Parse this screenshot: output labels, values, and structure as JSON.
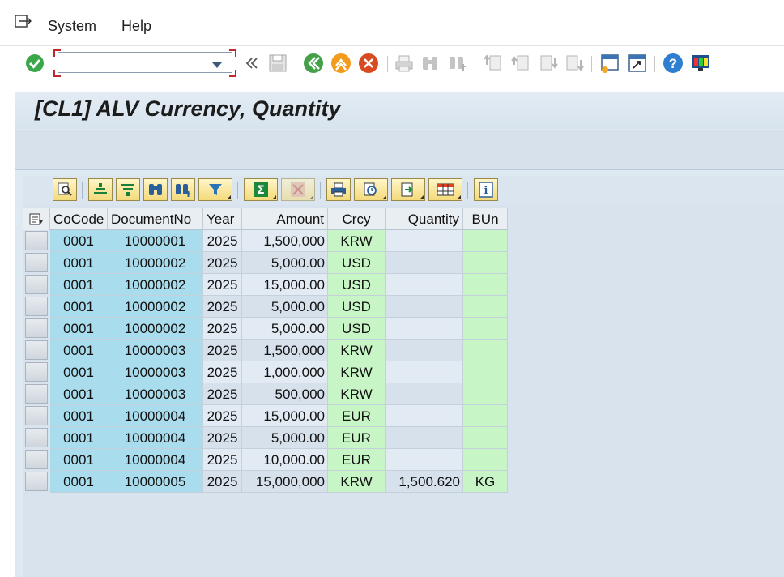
{
  "menu": {
    "items": [
      {
        "label": "System",
        "underline": "S",
        "rest": "ystem"
      },
      {
        "label": "Help",
        "underline": "H",
        "rest": "elp"
      }
    ]
  },
  "toolbar": {
    "command_field": {
      "value": "",
      "placeholder": ""
    },
    "icons": [
      "enter-icon",
      "command-field",
      "collapse-icon",
      "save-icon",
      "back-icon",
      "exit-icon",
      "cancel-icon",
      "print-icon",
      "find-icon",
      "find-next-icon",
      "first-page-icon",
      "previous-page-icon",
      "next-page-icon",
      "last-page-icon",
      "create-session-icon",
      "shortcut-icon",
      "help-icon",
      "layout-icon"
    ]
  },
  "title": "[CL1] ALV Currency, Quantity",
  "alv_toolbar": {
    "icons": [
      "details-icon",
      "sort-ascending-icon",
      "sort-descending-icon",
      "find-icon",
      "find-next-icon",
      "filter-icon",
      "total-icon",
      "subtotal-icon",
      "print-preview-icon",
      "views-icon",
      "export-icon",
      "layout-icon",
      "information-icon"
    ]
  },
  "grid": {
    "columns": [
      "CoCode",
      "DocumentNo",
      "Year",
      "Amount",
      "Crcy",
      "Quantity",
      "BUn"
    ],
    "rows": [
      [
        "0001",
        "10000001",
        "2025",
        "1,500,000",
        "KRW",
        "",
        ""
      ],
      [
        "0001",
        "10000002",
        "2025",
        "5,000.00",
        "USD",
        "",
        ""
      ],
      [
        "0001",
        "10000002",
        "2025",
        "15,000.00",
        "USD",
        "",
        ""
      ],
      [
        "0001",
        "10000002",
        "2025",
        "5,000.00",
        "USD",
        "",
        ""
      ],
      [
        "0001",
        "10000002",
        "2025",
        "5,000.00",
        "USD",
        "",
        ""
      ],
      [
        "0001",
        "10000003",
        "2025",
        "1,500,000",
        "KRW",
        "",
        ""
      ],
      [
        "0001",
        "10000003",
        "2025",
        "1,000,000",
        "KRW",
        "",
        ""
      ],
      [
        "0001",
        "10000003",
        "2025",
        "500,000",
        "KRW",
        "",
        ""
      ],
      [
        "0001",
        "10000004",
        "2025",
        "15,000.00",
        "EUR",
        "",
        ""
      ],
      [
        "0001",
        "10000004",
        "2025",
        "5,000.00",
        "EUR",
        "",
        ""
      ],
      [
        "0001",
        "10000004",
        "2025",
        "10,000.00",
        "EUR",
        "",
        ""
      ],
      [
        "0001",
        "10000005",
        "2025",
        "15,000,000",
        "KRW",
        "1,500.620",
        "KG"
      ]
    ]
  },
  "colors": {
    "key_column": "#a9dcec",
    "currency_unit_column": "#c8f5c6",
    "alv_button": "#f4da7a",
    "enter_green": "#3aa84a"
  }
}
